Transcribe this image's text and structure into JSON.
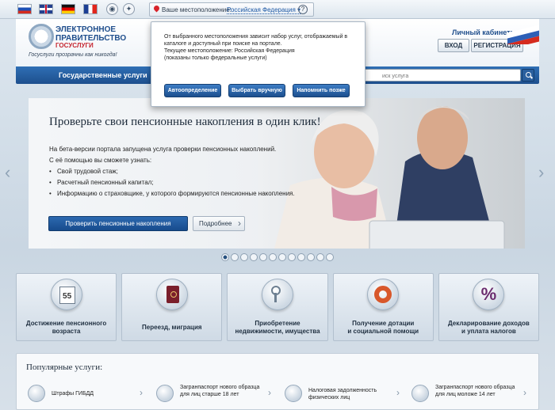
{
  "topbar": {
    "location_label": "Ваше местоположение:",
    "location_value": "Российская Федерация ▾",
    "help_glyph": "?",
    "icons": [
      "flag-ru-icon",
      "flag-uk-icon",
      "flag-de-icon",
      "flag-fr-icon",
      "eye-icon",
      "compass-icon"
    ]
  },
  "header": {
    "logo_line1": "ЭЛЕКТРОННОЕ",
    "logo_line2": "ПРАВИТЕЛЬСТВО",
    "logo_line3": "ГОСУСЛУГИ",
    "slogan": "Госуслуги прозрачны как никогда!",
    "cabinet_label": "Личный кабинет:",
    "login_label": "ВХОД",
    "register_label": "РЕГИСТРАЦИЯ"
  },
  "nav": {
    "item_services": "Государственные услуги",
    "search_placeholder": "иск услуга"
  },
  "popup": {
    "line1": "От выбранного местоположения зависит набор услуг, отображаемый в",
    "line2": "каталоге и доступный при поиске на портале.",
    "line3": "Текущее местоположение: Российская Федерация",
    "line4": "(показаны только федеральные услуги)",
    "btn_auto": "Автоопределение",
    "btn_manual": "Выбрать вручную",
    "btn_later": "Напомнить позже"
  },
  "banner": {
    "title": "Проверьте свои пенсионные накопления в один клик!",
    "intro": "На бета-версии портала запущена услуга проверки пенсионных накоплений.",
    "sub": "С её помощью вы сможете узнать:",
    "bullets": [
      "Свой трудовой стаж;",
      "Расчетный пенсионный капитал;",
      "Информацию о страховщике, у которого формируются пенсионные накопления."
    ],
    "btn_check": "Проверить пенсионные накопления",
    "btn_more": "Подробнее",
    "slide_count": 12,
    "active_slide": 1
  },
  "tiles": [
    {
      "line1": "Достижение пенсионного",
      "line2": "возраста",
      "icon": "calendar-icon",
      "cal_number": "55"
    },
    {
      "line1": "Переезд, миграция",
      "line2": "",
      "icon": "passport-icon"
    },
    {
      "line1": "Приобретение",
      "line2": "недвижимости, имущества",
      "icon": "keys-icon"
    },
    {
      "line1": "Получение дотации",
      "line2": "и социальной помощи",
      "icon": "lifebuoy-icon"
    },
    {
      "line1": "Декларирование доходов",
      "line2": "и уплата налогов",
      "icon": "percent-icon",
      "glyph": "%"
    }
  ],
  "popular": {
    "title": "Популярные услуги:",
    "items": [
      {
        "label": "Штрафы ГИБДД",
        "icon": "traffic-light-icon"
      },
      {
        "label": "Загранпаспорт нового образца для лиц старше 18 лет",
        "icon": "passport-icon"
      },
      {
        "label": "Налоговая задолженность физических лиц",
        "icon": "tax-icon"
      },
      {
        "label": "Загранпаспорт нового образца для лиц моложе 14 лет",
        "icon": "passport-icon"
      }
    ]
  },
  "colors": {
    "brand_blue": "#1d4f8d",
    "accent_red": "#c5252f"
  }
}
